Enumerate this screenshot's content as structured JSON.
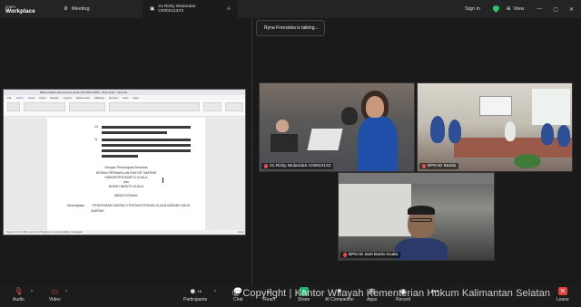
{
  "titlebar": {
    "brand_line1": "zoom",
    "brand_line2": "Workplace",
    "tabs": [
      {
        "label": "Meeting"
      },
      {
        "label": "21.Rizky Wulandari C00022132's"
      }
    ],
    "signin_label": "Sign in",
    "view_label": "View"
  },
  "talking_indicator": "Ryna Frensiska is talking...",
  "shared_screen": {
    "window_title": "Bahan Rapat Harmonisasi perda 125.2025 edNR - Word Help - Cloud Si...",
    "menu": [
      "File",
      "Home",
      "Insert",
      "Draw",
      "Design",
      "Layout",
      "References",
      "Mailings",
      "Review",
      "View",
      "Help"
    ],
    "active_menu": "Home",
    "line_numbers": [
      "10.",
      "11."
    ],
    "lines": [
      "Dengan Persetujuan Bersama",
      "DEWAN PERWAKILAN RAKYAT DAERAH",
      "KABUPATEN BARITO KUALA",
      "dan",
      "BUPATI BARITO KUALA"
    ],
    "memutuskan": "MEMUTUSKAN:",
    "menetapkan_label": "Menetapkan",
    "menetapkan_text": ": PERATURAN DAERAH TENTANG PENGELOLAAN BARANG MILIK DAERAH",
    "status_left": "Page 10 of 13  4.551 words  Text Predictions: On  Accessibility: Investigate",
    "status_right": "Focus"
  },
  "videos": [
    {
      "name": "21.Rizky Wulandari C00022132"
    },
    {
      "name": "BPKAD Batola"
    },
    {
      "name": "BPKAD aset Barito Kuala"
    }
  ],
  "toolbar": {
    "audio": "Audio",
    "video": "Video",
    "participants": "Participants",
    "participants_count": "16",
    "chat": "Chat",
    "react": "React",
    "share": "Share",
    "ai": "AI Companion",
    "apps": "Apps",
    "record": "Record",
    "leave": "Leave"
  },
  "watermark": "© Copyright | Kantor Wilayah Kementerian Hukum Kalimantan Selatan",
  "colors": {
    "share_green": "#23b26d",
    "leave_red": "#e23c3c",
    "background": "#1a1a1a"
  }
}
